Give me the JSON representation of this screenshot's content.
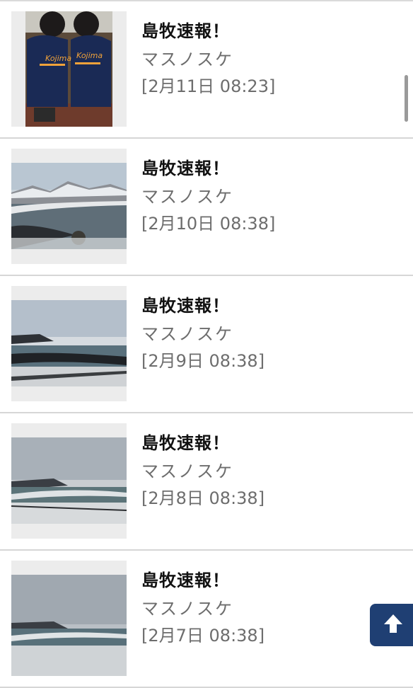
{
  "feed": {
    "items": [
      {
        "title": "島牧速報！",
        "author": "マスノスケ",
        "date": "[2月11日 08:23]",
        "thumbnail": "kids-tshirts-photo"
      },
      {
        "title": "島牧速報！",
        "author": "マスノスケ",
        "date": "[2月10日 08:38]",
        "thumbnail": "snowy-coast-photo"
      },
      {
        "title": "島牧速報！",
        "author": "マスノスケ",
        "date": "[2月9日 08:38]",
        "thumbnail": "winter-beach-photo"
      },
      {
        "title": "島牧速報！",
        "author": "マスノスケ",
        "date": "[2月8日 08:38]",
        "thumbnail": "cloudy-shore-photo"
      },
      {
        "title": "島牧速報！",
        "author": "マスノスケ",
        "date": "[2月7日 08:38]",
        "thumbnail": "overcast-sea-photo"
      }
    ]
  },
  "ui": {
    "back_to_top_icon": "up-arrow-icon",
    "accent_color": "#1f3f73"
  }
}
